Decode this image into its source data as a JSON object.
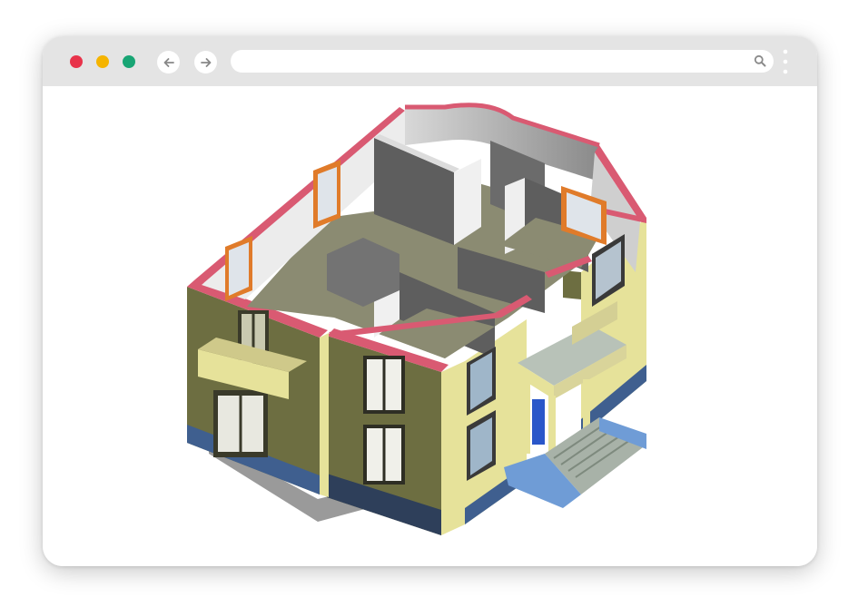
{
  "window": {
    "colors": {
      "close": "#e8334a",
      "minimize": "#f5b400",
      "maximize": "#18a574"
    }
  },
  "navigation": {
    "back_icon": "arrow-left-icon",
    "forward_icon": "arrow-right-icon"
  },
  "address_bar": {
    "value": "",
    "placeholder": "",
    "search_icon": "search-icon"
  },
  "menu": {
    "icon": "kebab-menu-icon"
  },
  "content": {
    "image": "isometric-house-cutaway-3d-model",
    "colors": {
      "wall_olive": "#6d6e41",
      "wall_cream": "#e6e29a",
      "cut_edge_red": "#d95a72",
      "floor": "#8b8b72",
      "interior_wall": "#5e5e5e",
      "foundation_blue": "#3f5f8f"
    }
  }
}
